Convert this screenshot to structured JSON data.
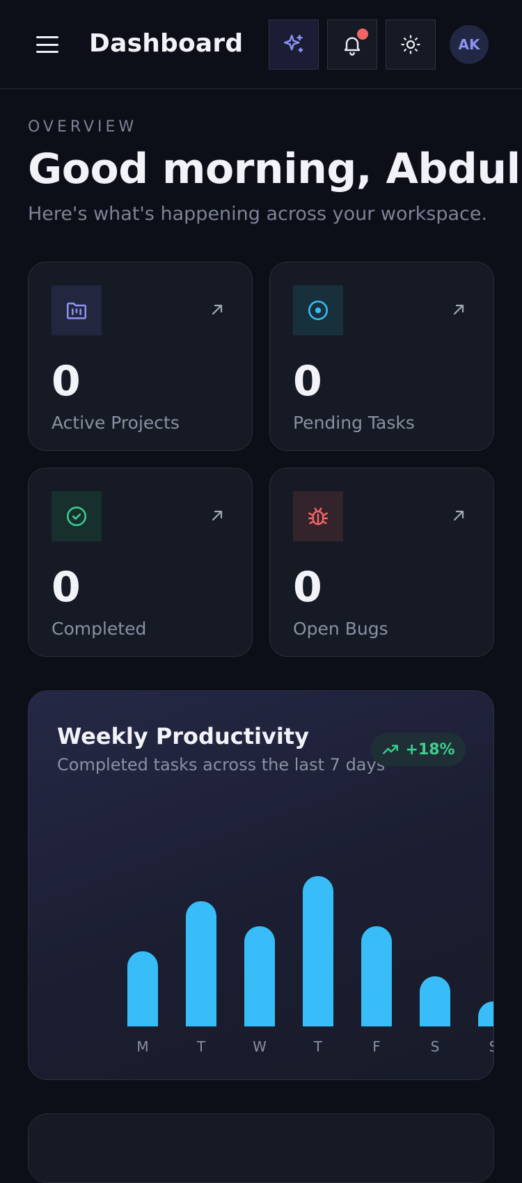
{
  "header": {
    "title": "Dashboard",
    "avatar_initials": "AK",
    "icons": [
      "menu-icon",
      "sparkle-icon",
      "bell-icon",
      "sun-icon"
    ],
    "notification_dot_color": "#f06464"
  },
  "hero": {
    "overline": "OVERVIEW",
    "greeting": "Good morning, Abdul",
    "subtitle": "Here's what's happening across your workspace."
  },
  "stats": [
    {
      "value": "0",
      "label": "Active Projects",
      "icon": "folder-kanban-icon",
      "color": "#8a93f0"
    },
    {
      "value": "0",
      "label": "Pending Tasks",
      "icon": "target-icon",
      "color": "#38bdf8"
    },
    {
      "value": "0",
      "label": "Completed",
      "icon": "check-circle-icon",
      "color": "#3ecf8e"
    },
    {
      "value": "0",
      "label": "Open Bugs",
      "icon": "bug-icon",
      "color": "#f06464"
    }
  ],
  "chart": {
    "title": "Weekly Productivity",
    "subtitle": "Completed tasks across the last 7 days",
    "trend": "+18%",
    "trend_color": "#3ecf8e",
    "bar_color": "#38bdf8"
  },
  "chart_data": {
    "type": "bar",
    "categories": [
      "M",
      "T",
      "W",
      "T",
      "F",
      "S",
      "S"
    ],
    "values": [
      45,
      75,
      60,
      90,
      60,
      30,
      15
    ],
    "ylim": [
      0,
      100
    ],
    "grid": false,
    "xlabel": "",
    "ylabel": ""
  }
}
